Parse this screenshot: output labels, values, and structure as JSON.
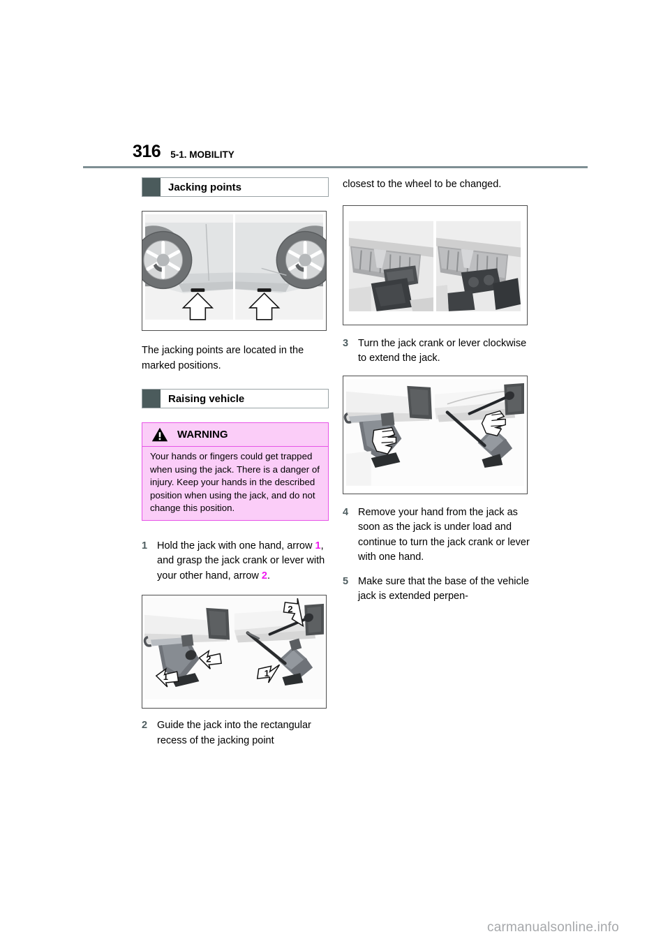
{
  "header": {
    "page_number": "316",
    "section": "5-1. MOBILITY"
  },
  "left_column": {
    "section_title_1": "Jacking points",
    "paragraph_1": "The jacking points are located in the marked positions.",
    "section_title_2": "Raising vehicle",
    "warning": {
      "title": "WARNING",
      "icon": "warning-triangle-icon",
      "body": "Your hands or fingers could get trapped when using the jack. There is a danger of injury. Keep your hands in the described position when using the jack, and do not change this position.",
      "border_color": "#e754e7",
      "fill_color": "#fbcdf8"
    },
    "steps": [
      {
        "number": "1",
        "text_before_ref1": "Hold the jack with one hand, arrow ",
        "ref1": "1",
        "text_mid": ", and grasp the jack crank or lever with your other hand, arrow ",
        "ref2": "2",
        "text_after": "."
      },
      {
        "number": "2",
        "text": "Guide the jack into the rectangular recess of the jacking point"
      }
    ],
    "figures": {
      "jacking_points": {
        "caption_name": "vehicle-side-jacking-point-locations",
        "callouts": [
          "arrow-up-outline",
          "arrow-up-outline"
        ]
      },
      "jack_hands": {
        "caption_name": "jack-hand-positions",
        "callouts": [
          "1",
          "2",
          "1",
          "2"
        ]
      }
    }
  },
  "right_column": {
    "paragraph_continued": "closest to the wheel to be changed.",
    "steps": [
      {
        "number": "3",
        "text": "Turn the jack crank or lever clockwise to extend the jack."
      },
      {
        "number": "4",
        "text": "Remove your hand from the jack as soon as the jack is under load and continue to turn the jack crank or lever with one hand."
      },
      {
        "number": "5",
        "text": "Make sure that the base of the vehicle jack is extended perpen-"
      }
    ],
    "figures": {
      "jack_closeup": {
        "caption_name": "jacking-point-recess-closeup"
      },
      "jack_under_load": {
        "caption_name": "jack-extended-under-load"
      }
    }
  },
  "footer": {
    "watermark": "carmanualsonline.info"
  },
  "colors": {
    "rule": "#7e8f93",
    "swatch": "#4b5b5c",
    "step_number": "#4e5d60",
    "reference_magenta": "#ee19ee",
    "watermark": "#a6a8ab"
  }
}
